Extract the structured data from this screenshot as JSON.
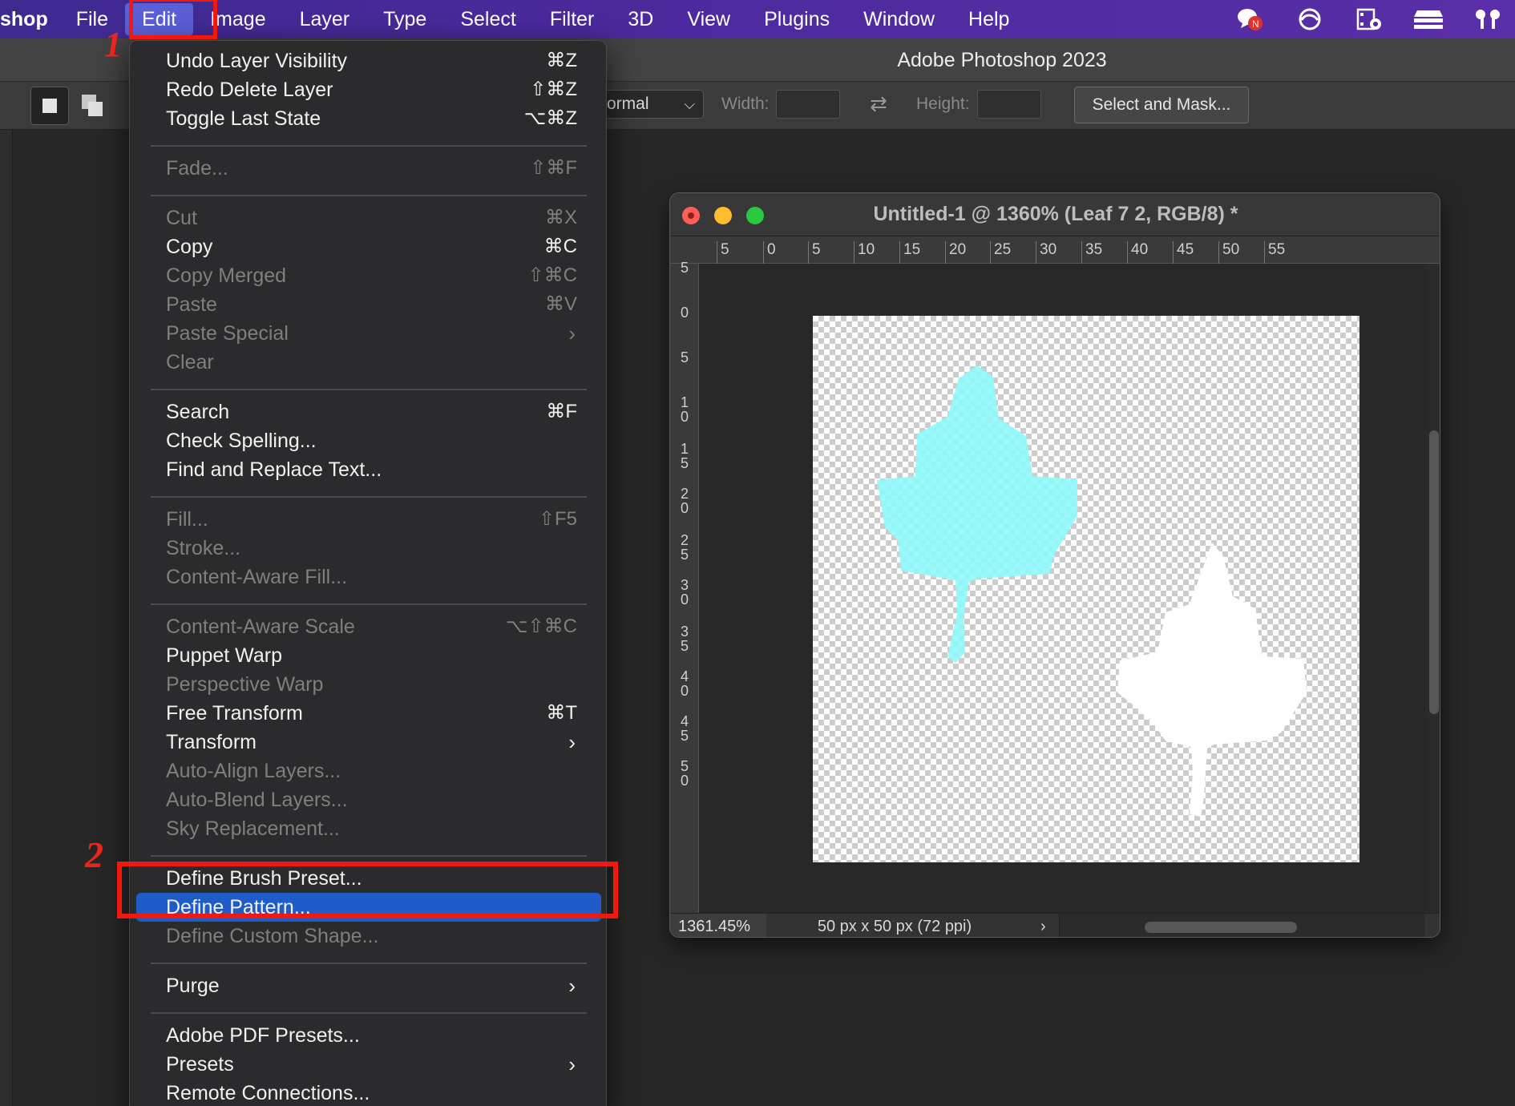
{
  "menubar": {
    "app_name": "shop",
    "items": [
      "File",
      "Edit",
      "Image",
      "Layer",
      "Type",
      "Select",
      "Filter",
      "3D",
      "View",
      "Plugins",
      "Window",
      "Help"
    ],
    "status_icons": [
      "notification-badge-icon",
      "creative-cloud-icon",
      "film-record-icon",
      "display-stack-icon",
      "airpods-icon"
    ]
  },
  "app": {
    "window_title": "Adobe Photoshop 2023"
  },
  "options": {
    "style_value": "ormal",
    "width_label": "Width:",
    "height_label": "Height:",
    "select_mask_label": "Select and Mask..."
  },
  "document": {
    "title": "Untitled-1 @ 1360% (Leaf 7 2, RGB/8) *",
    "ruler_top": [
      "5",
      "0",
      "5",
      "10",
      "15",
      "20",
      "25",
      "30",
      "35",
      "40",
      "45",
      "50",
      "55"
    ],
    "ruler_left": [
      "5",
      "0",
      "5",
      "1\n0",
      "1\n5",
      "2\n0",
      "2\n5",
      "3\n0",
      "3\n5",
      "4\n0",
      "4\n5",
      "5\n0"
    ],
    "zoom": "1361.45%",
    "info": "50 px x 50 px (72 ppi)",
    "leaf_colors": {
      "cyan": "#8ff9fb",
      "white": "#ffffff"
    }
  },
  "edit_menu": {
    "groups": [
      [
        {
          "label": "Undo Layer Visibility",
          "shortcut": "⌘Z",
          "disabled": false
        },
        {
          "label": "Redo Delete Layer",
          "shortcut": "⇧⌘Z",
          "disabled": false
        },
        {
          "label": "Toggle Last State",
          "shortcut": "⌥⌘Z",
          "disabled": false
        }
      ],
      [
        {
          "label": "Fade...",
          "shortcut": "⇧⌘F",
          "disabled": true
        }
      ],
      [
        {
          "label": "Cut",
          "shortcut": "⌘X",
          "disabled": true
        },
        {
          "label": "Copy",
          "shortcut": "⌘C",
          "disabled": false
        },
        {
          "label": "Copy Merged",
          "shortcut": "⇧⌘C",
          "disabled": true
        },
        {
          "label": "Paste",
          "shortcut": "⌘V",
          "disabled": true
        },
        {
          "label": "Paste Special",
          "submenu": true,
          "disabled": true
        },
        {
          "label": "Clear",
          "disabled": true
        }
      ],
      [
        {
          "label": "Search",
          "shortcut": "⌘F",
          "disabled": false
        },
        {
          "label": "Check Spelling...",
          "disabled": false
        },
        {
          "label": "Find and Replace Text...",
          "disabled": false
        }
      ],
      [
        {
          "label": "Fill...",
          "shortcut": "⇧F5",
          "disabled": true
        },
        {
          "label": "Stroke...",
          "disabled": true
        },
        {
          "label": "Content-Aware Fill...",
          "disabled": true
        }
      ],
      [
        {
          "label": "Content-Aware Scale",
          "shortcut": "⌥⇧⌘C",
          "disabled": true
        },
        {
          "label": "Puppet Warp",
          "disabled": false
        },
        {
          "label": "Perspective Warp",
          "disabled": true
        },
        {
          "label": "Free Transform",
          "shortcut": "⌘T",
          "disabled": false
        },
        {
          "label": "Transform",
          "submenu": true,
          "disabled": false
        },
        {
          "label": "Auto-Align Layers...",
          "disabled": true
        },
        {
          "label": "Auto-Blend Layers...",
          "disabled": true
        },
        {
          "label": "Sky Replacement...",
          "disabled": true
        }
      ],
      [
        {
          "label": "Define Brush Preset...",
          "disabled": false
        },
        {
          "label": "Define Pattern...",
          "disabled": false,
          "selected": true
        },
        {
          "label": "Define Custom Shape...",
          "disabled": true
        }
      ],
      [
        {
          "label": "Purge",
          "submenu": true,
          "disabled": false
        }
      ],
      [
        {
          "label": "Adobe PDF Presets...",
          "disabled": false
        },
        {
          "label": "Presets",
          "submenu": true,
          "disabled": false
        },
        {
          "label": "Remote Connections...",
          "disabled": false
        }
      ]
    ]
  },
  "annotations": {
    "step1": "1",
    "step2": "2",
    "highlight_color": "#f1180d"
  }
}
